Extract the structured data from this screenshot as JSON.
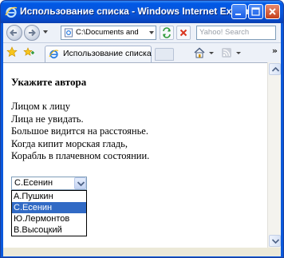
{
  "window": {
    "title": "Использование списка - Windows Internet Explorer"
  },
  "toolbar": {
    "address": "C:\\Documents and Se",
    "search_placeholder": "Yahoo! Search"
  },
  "tabs": [
    {
      "label": "Использование списка"
    }
  ],
  "page": {
    "heading": "Укажите автора",
    "poem_lines": [
      "Лицом к лицу",
      "Лица не увидать.",
      "Большое видится на расстоянье.",
      "Когда кипит морская гладь,",
      "Корабль в плачевном состоянии."
    ],
    "select": {
      "value": "С.Есенин",
      "options": [
        "А.Пушкин",
        "С.Есенин",
        "Ю.Лермонтов",
        "В.Высоцкий"
      ],
      "highlighted_index": 1
    }
  },
  "colors": {
    "titlebar": "#0a55d8",
    "highlight": "#316ac5"
  },
  "icons": {
    "tab_favicon": "ie-page-icon",
    "favorites": "star-icon",
    "add_favorites": "add-favorites-icon",
    "home": "home-icon",
    "feeds": "rss-icon"
  }
}
